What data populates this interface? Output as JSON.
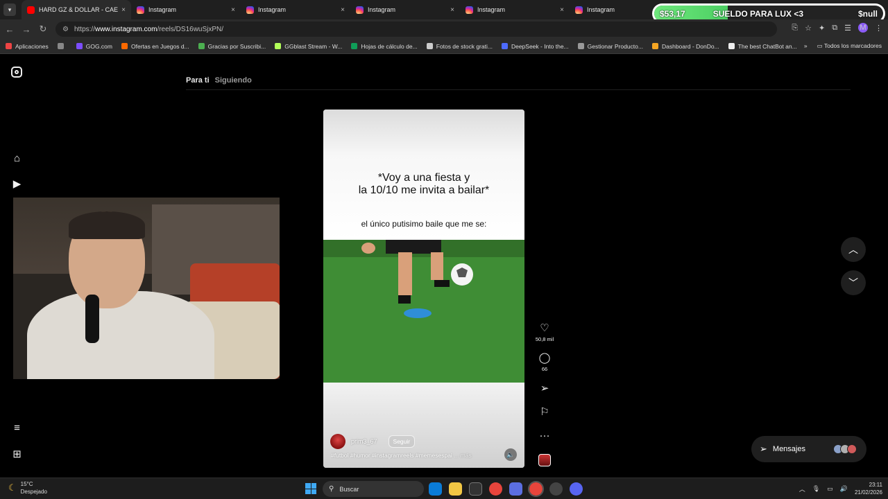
{
  "browser": {
    "tabs": [
      {
        "label": "HARD GZ & DOLLAR - CAE LA",
        "favicon": "youtube"
      },
      {
        "label": "Instagram",
        "favicon": "instagram"
      },
      {
        "label": "Instagram",
        "favicon": "instagram"
      },
      {
        "label": "Instagram",
        "favicon": "instagram"
      },
      {
        "label": "Instagram",
        "favicon": "instagram"
      },
      {
        "label": "Instagram",
        "favicon": "instagram"
      }
    ],
    "tab_close": "×",
    "url_prefix": "https://",
    "url_host": "www.instagram.com",
    "url_path": "/reels/DS16wuSjxPN/",
    "profile_initial": "M",
    "bookmarks": [
      {
        "label": "Aplicaciones",
        "color": "#e44"
      },
      {
        "label": "",
        "color": "#888"
      },
      {
        "label": "GOG.com",
        "color": "#7c4dff"
      },
      {
        "label": "Ofertas en Juegos d...",
        "color": "#ff6a00"
      },
      {
        "label": "Gracias por Suscribi...",
        "color": "#4caf50"
      },
      {
        "label": "GGblast Stream - W...",
        "color": "#b2ff59"
      },
      {
        "label": "Hojas de cálculo de...",
        "color": "#0f9d58"
      },
      {
        "label": "Fotos de stock grati...",
        "color": "#ccc"
      },
      {
        "label": "DeepSeek - Into the...",
        "color": "#4d6bfe"
      },
      {
        "label": "Gestionar Producto...",
        "color": "#999"
      },
      {
        "label": "Dashboard - DonDo...",
        "color": "#f5a623"
      },
      {
        "label": "The best ChatBot an...",
        "color": "#eee"
      }
    ],
    "bookmarks_more": "»",
    "all_bookmarks": "Todos los marcadores"
  },
  "overlay": {
    "amount": "$53,17",
    "goal_text": "SUELDO PARA LUX <3",
    "right_text": "$null",
    "progress": 0.32
  },
  "instagram": {
    "feed_tabs": [
      "Para ti",
      "Siguiendo"
    ],
    "reel": {
      "title_line1": "*Voy a una fiesta y",
      "title_line2": "la 10/10 me invita a bailar*",
      "subtitle": "el único putisimo baile que me se:",
      "username": "prim3_67",
      "follow_label": "Seguir",
      "hashtags": "#futbol #humor #instagramreels #memesespai",
      "more": "... más"
    },
    "actions": {
      "likes": "50,8 mil",
      "comments": "66"
    },
    "messages_label": "Mensajes"
  },
  "taskbar": {
    "temperature": "15°C",
    "weather": "Despejado",
    "search_placeholder": "Buscar",
    "time": "23:11",
    "date": "21/02/2026"
  }
}
